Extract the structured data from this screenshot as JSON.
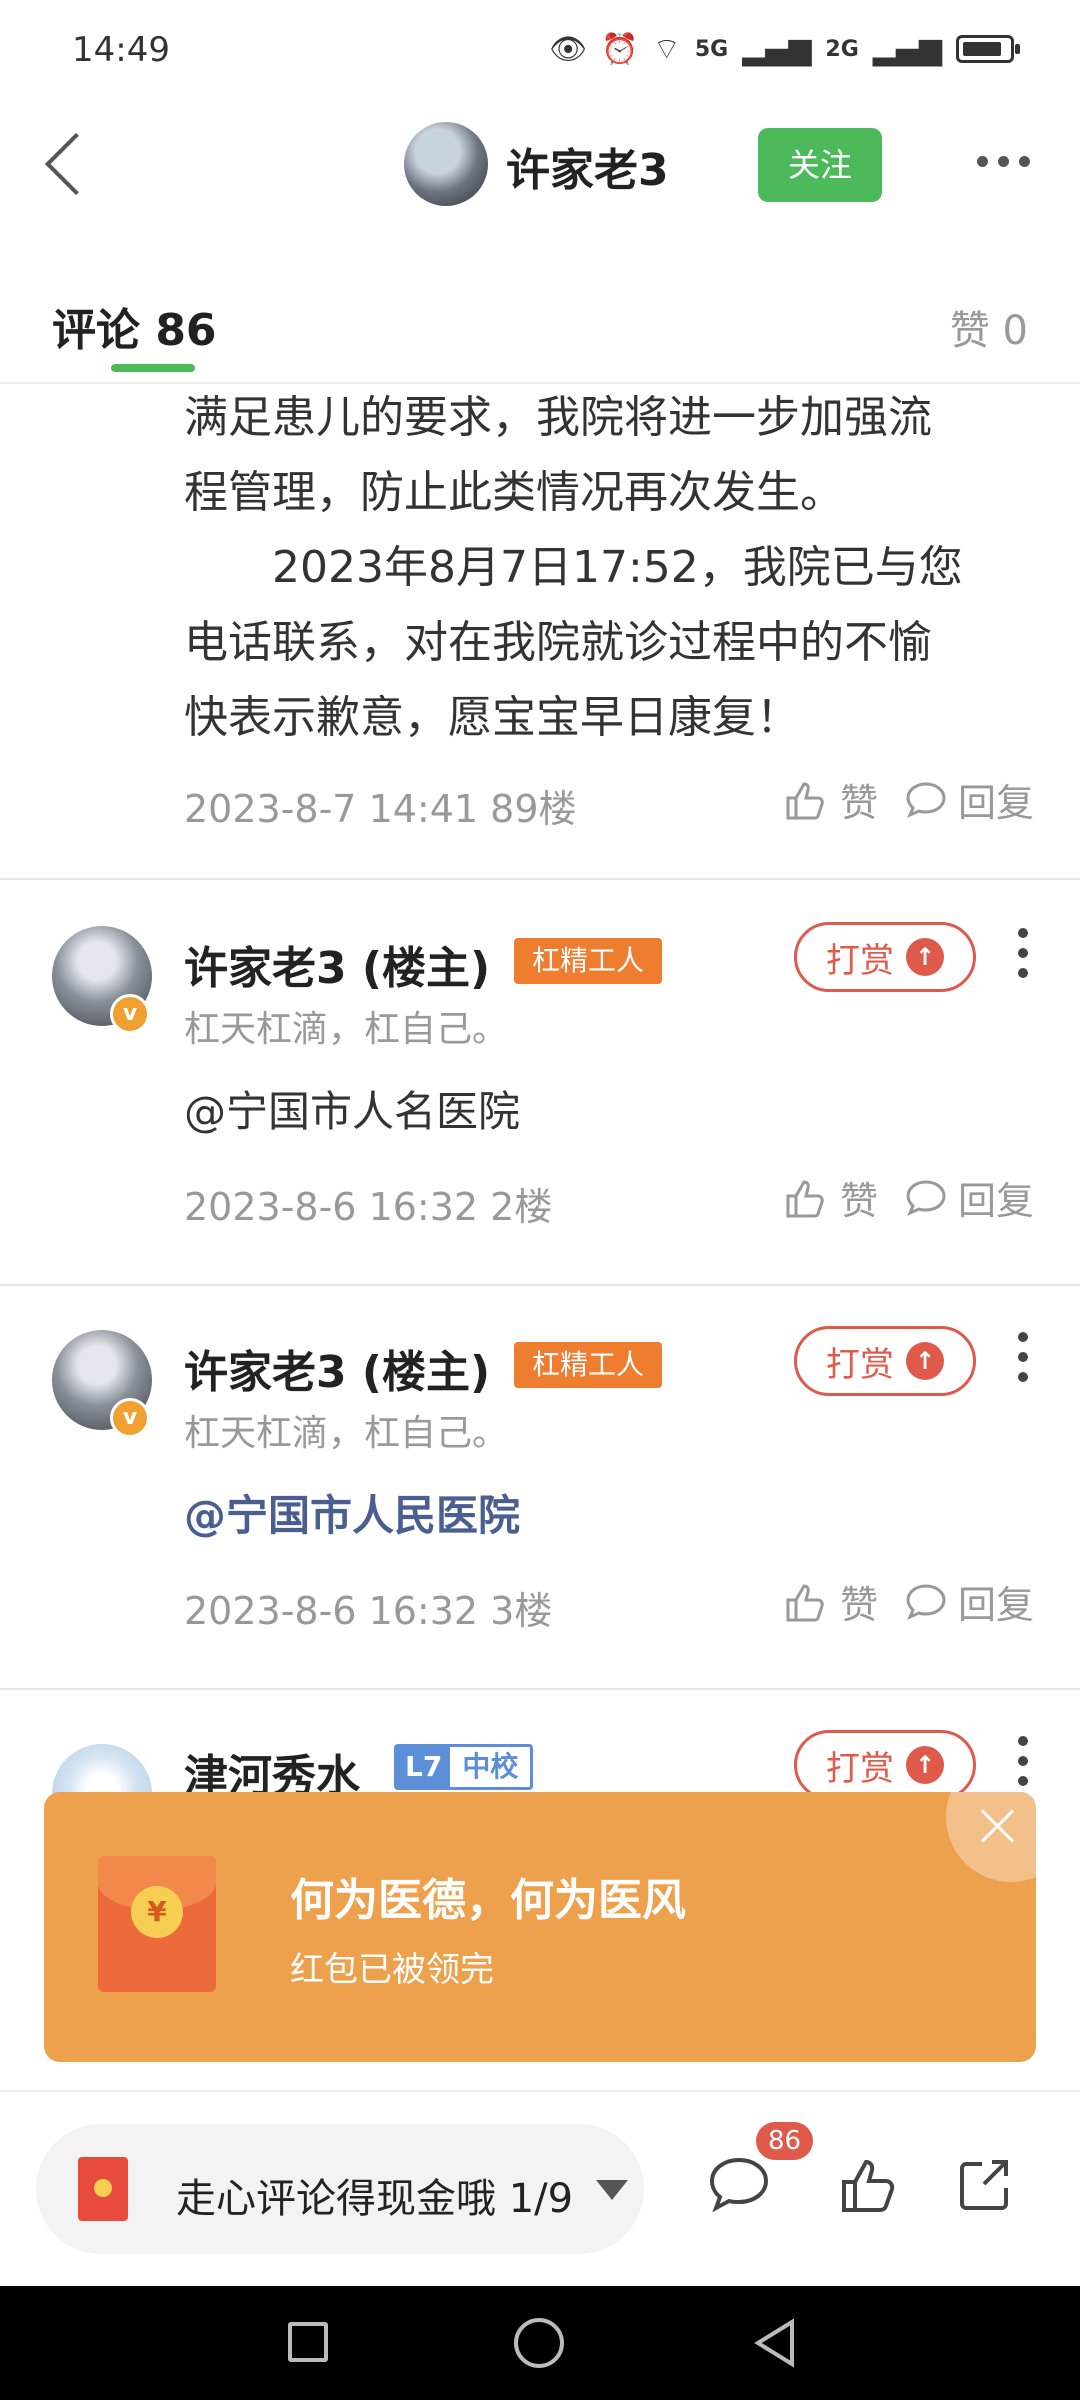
{
  "status_bar": {
    "time": "14:49",
    "signal1": "5G",
    "signal2": "2G"
  },
  "header": {
    "name": "许家老3",
    "follow_label": "关注"
  },
  "tabs": {
    "comments_label": "评论 86",
    "likes_label": "赞 0"
  },
  "reply_block": {
    "lines": [
      "满足患儿的要求，我院将进一步加强流",
      "程管理，防止此类情况再次发生。",
      "　　2023年8月7日17:52，我院已与您",
      "电话联系，对在我院就诊过程中的不愉",
      "快表示歉意，愿宝宝早日康复！"
    ],
    "date_floor": "2023-8-7 14:41  89楼",
    "like_label": "赞",
    "reply_label": "回复"
  },
  "comments": [
    {
      "name": "许家老3 (楼主)",
      "badge": "杠精工人",
      "signature": "杠天杠滴，杠自己。",
      "body": "@宁国市人名医院",
      "date_floor": "2023-8-6 16:32  2楼",
      "tip_label": "打赏",
      "like_label": "赞",
      "reply_label": "回复"
    },
    {
      "name": "许家老3 (楼主)",
      "badge": "杠精工人",
      "signature": "杠天杠滴，杠自己。",
      "body": "@宁国市人民医院",
      "date_floor": "2023-8-6 16:32  3楼",
      "tip_label": "打赏",
      "like_label": "赞",
      "reply_label": "回复"
    },
    {
      "name": "津河秀水",
      "level": "L7",
      "level_title": "中校",
      "tip_label": "打赏"
    }
  ],
  "red_packet": {
    "title": "何为医德，何为医风",
    "subtitle": "红包已被领完",
    "coin": "¥"
  },
  "bottom_bar": {
    "input_text": "走心评论得现金哦 1/9",
    "comment_count": "86"
  },
  "colors": {
    "accent_green": "#4cba5b",
    "tip_red": "#e05a4b",
    "badge_orange": "#ef7d2f",
    "banner_orange": "#eea14d",
    "mention_blue": "#4a5f8f"
  }
}
